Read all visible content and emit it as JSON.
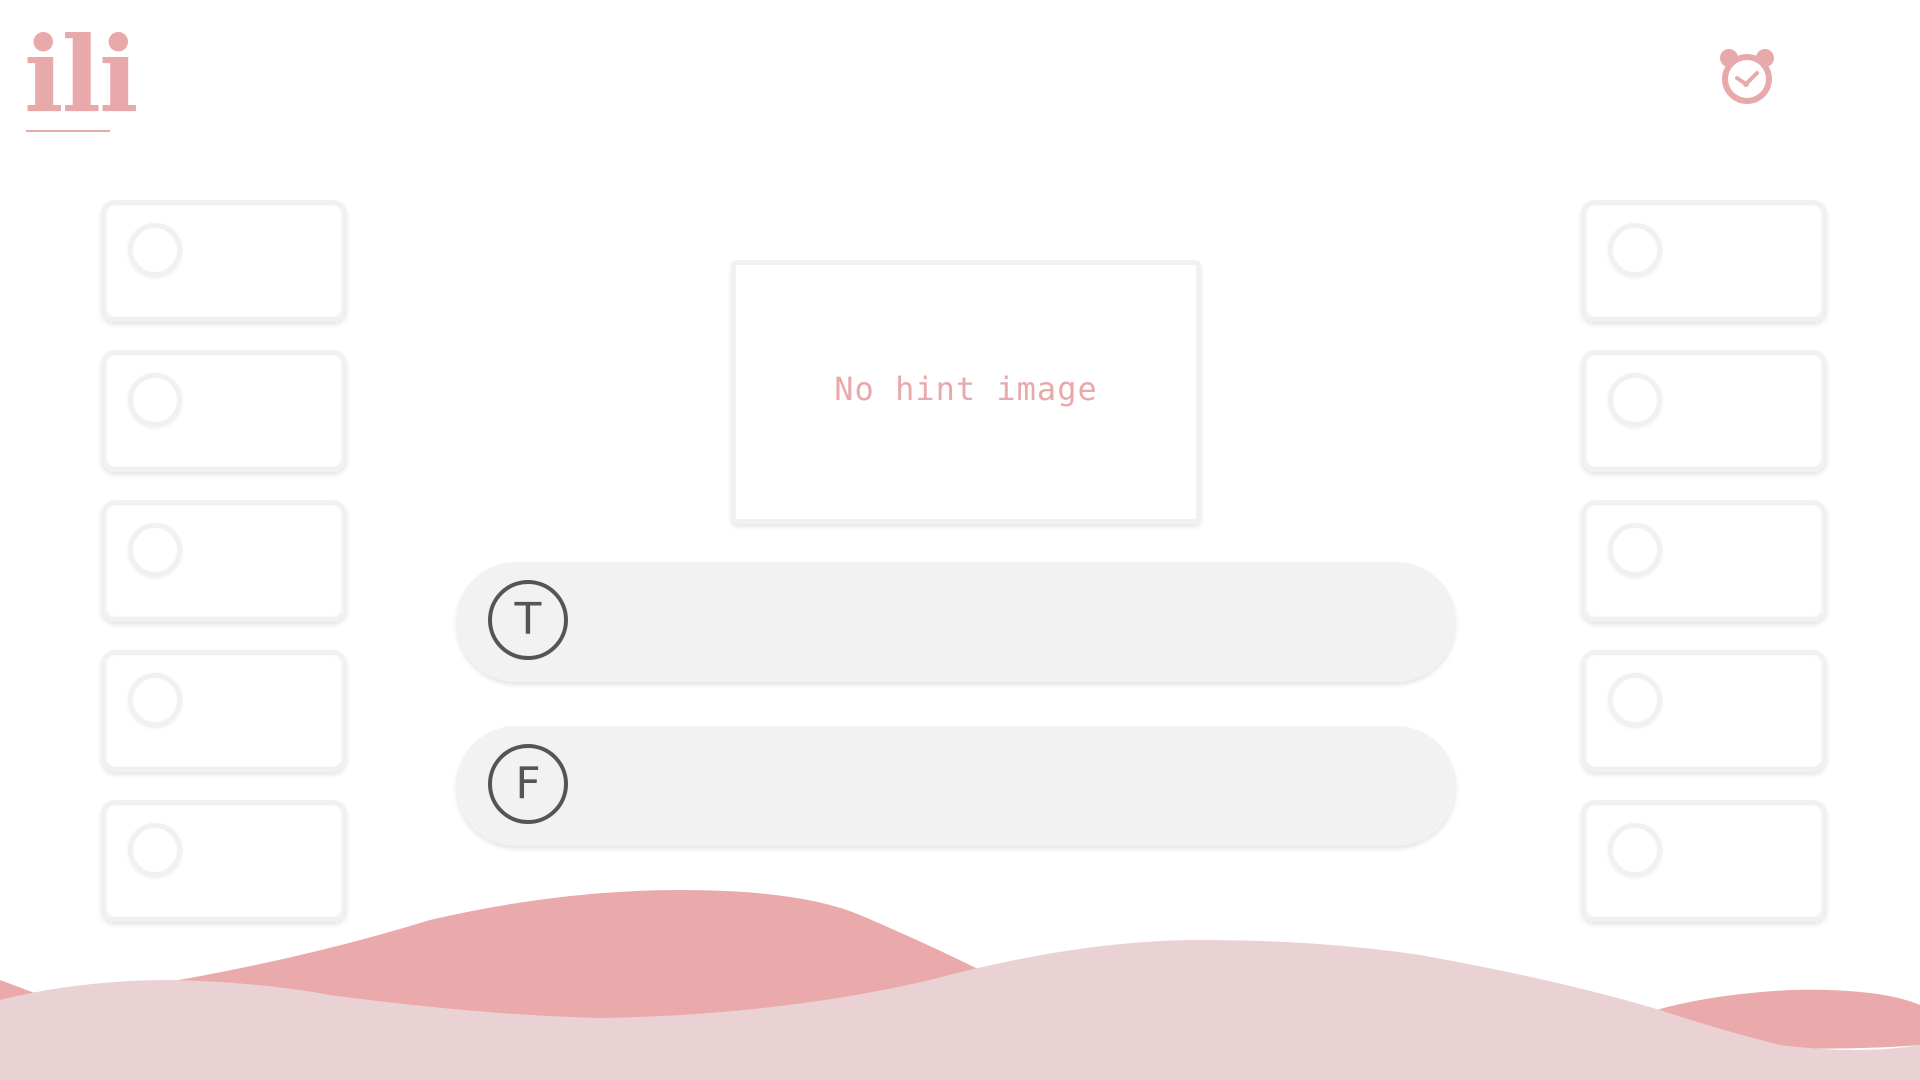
{
  "app": {
    "logo_text": "ili"
  },
  "header": {
    "timer_icon": "alarm-clock-icon"
  },
  "hint": {
    "placeholder_text": "No hint image"
  },
  "answers": [
    {
      "badge": "T",
      "label": ""
    },
    {
      "badge": "F",
      "label": ""
    }
  ],
  "left_slots": [
    {
      "label": ""
    },
    {
      "label": ""
    },
    {
      "label": ""
    },
    {
      "label": ""
    },
    {
      "label": ""
    }
  ],
  "right_slots": [
    {
      "label": ""
    },
    {
      "label": ""
    },
    {
      "label": ""
    },
    {
      "label": ""
    },
    {
      "label": ""
    }
  ],
  "colors": {
    "accent_pink": "#e8a9ab",
    "wave_dark": "#eaa9ab",
    "wave_light": "#ead2d4",
    "pill_bg": "#f2f2f2",
    "badge_stroke": "#555555"
  }
}
